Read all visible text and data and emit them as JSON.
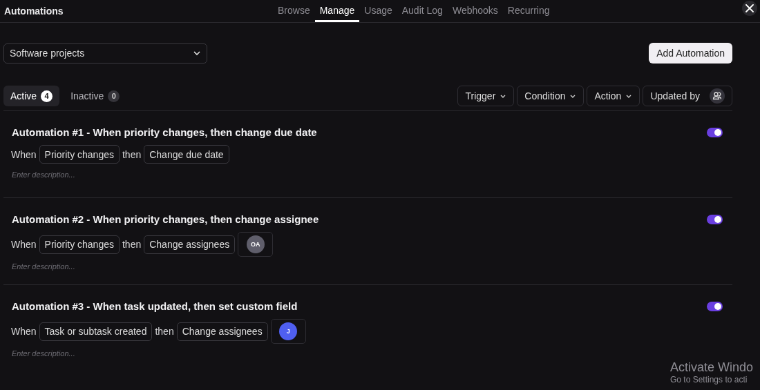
{
  "app_title": "Automations",
  "nav_tabs": [
    {
      "label": "Browse",
      "selected": false
    },
    {
      "label": "Manage",
      "selected": true
    },
    {
      "label": "Usage",
      "selected": false
    },
    {
      "label": "Audit Log",
      "selected": false
    },
    {
      "label": "Webhooks",
      "selected": false
    },
    {
      "label": "Recurring",
      "selected": false
    }
  ],
  "project_select": {
    "value": "Software projects"
  },
  "add_button": "Add Automation",
  "status_tabs": [
    {
      "label": "Active",
      "count": "4",
      "selected": true
    },
    {
      "label": "Inactive",
      "count": "0",
      "selected": false
    }
  ],
  "filters": [
    {
      "label": "Trigger",
      "kind": "dropdown"
    },
    {
      "label": "Condition",
      "kind": "dropdown"
    },
    {
      "label": "Action",
      "kind": "dropdown"
    },
    {
      "label": "Updated by",
      "kind": "people"
    }
  ],
  "automations": [
    {
      "title": "Automation #1 - When priority changes, then change due date",
      "on": true,
      "when_label": "When",
      "trigger": "Priority changes",
      "then_label": "then",
      "action": "Change due date",
      "description": {
        "placeholder": "Enter description..."
      }
    },
    {
      "title": "Automation #2 - When priority changes, then change assignee",
      "on": true,
      "when_label": "When",
      "trigger": "Priority changes",
      "then_label": "then",
      "action": "Change assignees",
      "assignee": {
        "initials": "OA",
        "color": "#5f5e6b"
      },
      "description": {
        "placeholder": "Enter description..."
      }
    },
    {
      "title": "Automation #3 - When task updated, then set custom field",
      "on": true,
      "when_label": "When",
      "trigger": "Task or subtask created",
      "then_label": "then",
      "action": "Change assignees",
      "assignee": {
        "initials": "J",
        "color": "#4f5ff0"
      },
      "description": {
        "placeholder": "Enter description..."
      }
    }
  ],
  "os_notice": {
    "title": "Activate Windo",
    "subtitle": "Go to Settings to acti"
  }
}
